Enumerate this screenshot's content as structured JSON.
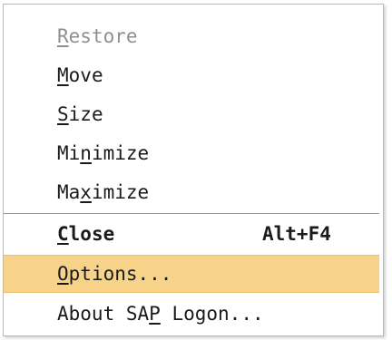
{
  "menu": {
    "items": [
      {
        "pre": "",
        "mn": "R",
        "post": "estore",
        "state": "disabled"
      },
      {
        "pre": "",
        "mn": "M",
        "post": "ove",
        "state": "normal"
      },
      {
        "pre": "",
        "mn": "S",
        "post": "ize",
        "state": "normal"
      },
      {
        "pre": "Mi",
        "mn": "n",
        "post": "imize",
        "state": "normal"
      },
      {
        "pre": "Ma",
        "mn": "x",
        "post": "imize",
        "state": "normal"
      },
      {
        "pre": "",
        "mn": "C",
        "post": "lose",
        "state": "bold",
        "shortcut": "Alt+F4"
      },
      {
        "pre": "",
        "mn": "O",
        "post": "ptions...",
        "state": "highlighted"
      },
      {
        "pre": "About SA",
        "mn": "P",
        "post": " Logon...",
        "state": "normal"
      }
    ]
  },
  "colors": {
    "highlight": "#f7d38a",
    "disabled_text": "#8f8f8f",
    "text": "#1a1a1a"
  }
}
